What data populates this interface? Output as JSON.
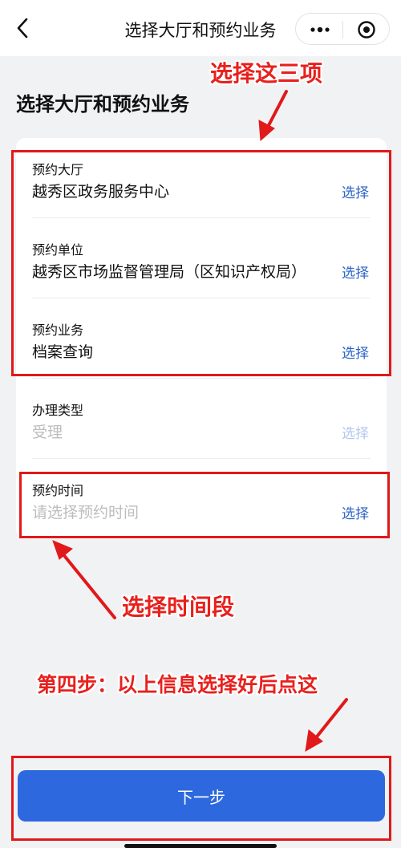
{
  "nav": {
    "title": "选择大厅和预约业务"
  },
  "page": {
    "title": "选择大厅和预约业务"
  },
  "form": {
    "rows": [
      {
        "label": "预约大厅",
        "value": "越秀区政务服务中心",
        "action": "选择"
      },
      {
        "label": "预约单位",
        "value": "越秀区市场监督管理局（区知识产权局）",
        "action": "选择"
      },
      {
        "label": "预约业务",
        "value": "档案查询",
        "action": "选择"
      },
      {
        "label": "办理类型",
        "value": "受理",
        "action": "选择"
      },
      {
        "label": "预约时间",
        "placeholder": "请选择预约时间",
        "action": "选择"
      }
    ]
  },
  "annotations": {
    "top": "选择这三项",
    "middle": "选择时间段",
    "bottom": "第四步：以上信息选择好后点这"
  },
  "footer": {
    "next_label": "下一步"
  },
  "colors": {
    "link": "#2c63c6",
    "primary": "#2d68df",
    "annotation": "#e8201d"
  }
}
